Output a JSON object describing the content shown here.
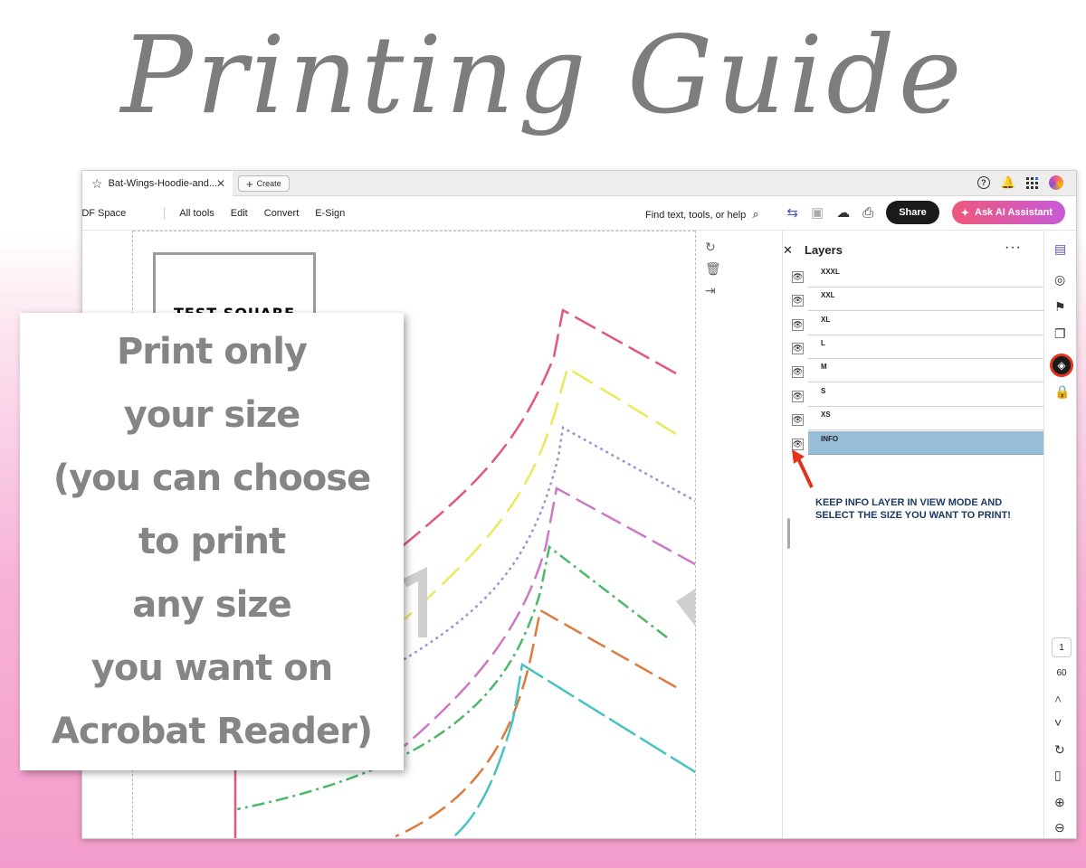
{
  "heading": "Printing Guide",
  "tab": {
    "title": "Bat-Wings-Hoodie-and...",
    "create_label": "Create"
  },
  "toolbar": {
    "pdf_space": "PDF Space",
    "menu": [
      "All tools",
      "Edit",
      "Convert",
      "E-Sign"
    ],
    "find_text": "Find text, tools, or help",
    "share_label": "Share",
    "ai_label": "Ask AI Assistant"
  },
  "document": {
    "test_square_label": "TEST SQUARE"
  },
  "layers_panel": {
    "title": "Layers",
    "layers": [
      {
        "name": "XXXL",
        "selected": false
      },
      {
        "name": "XXL",
        "selected": false
      },
      {
        "name": "XL",
        "selected": false
      },
      {
        "name": "L",
        "selected": false
      },
      {
        "name": "M",
        "selected": false
      },
      {
        "name": "S",
        "selected": false
      },
      {
        "name": "XS",
        "selected": false
      },
      {
        "name": "INFO",
        "selected": true
      }
    ],
    "note": "KEEP INFO LAYER IN VIEW MODE AND SELECT THE SIZE YOU WANT TO PRINT!"
  },
  "page_nav": {
    "current_page": "1",
    "total_pages": "60"
  },
  "overlay": {
    "lines": [
      "Print only",
      "your size",
      "(you can choose",
      "to print",
      "any size",
      "you want on",
      "Acrobat Reader)"
    ]
  },
  "colors": {
    "title_gray": "#7d7d7d",
    "selected_layer": "#97bdd9",
    "note_text": "#1c3a66",
    "highlight_ring": "#e0341e",
    "share_bg": "#1a1a1a",
    "ai_gradient_start": "#f0587c",
    "ai_gradient_end": "#c65bd8"
  }
}
